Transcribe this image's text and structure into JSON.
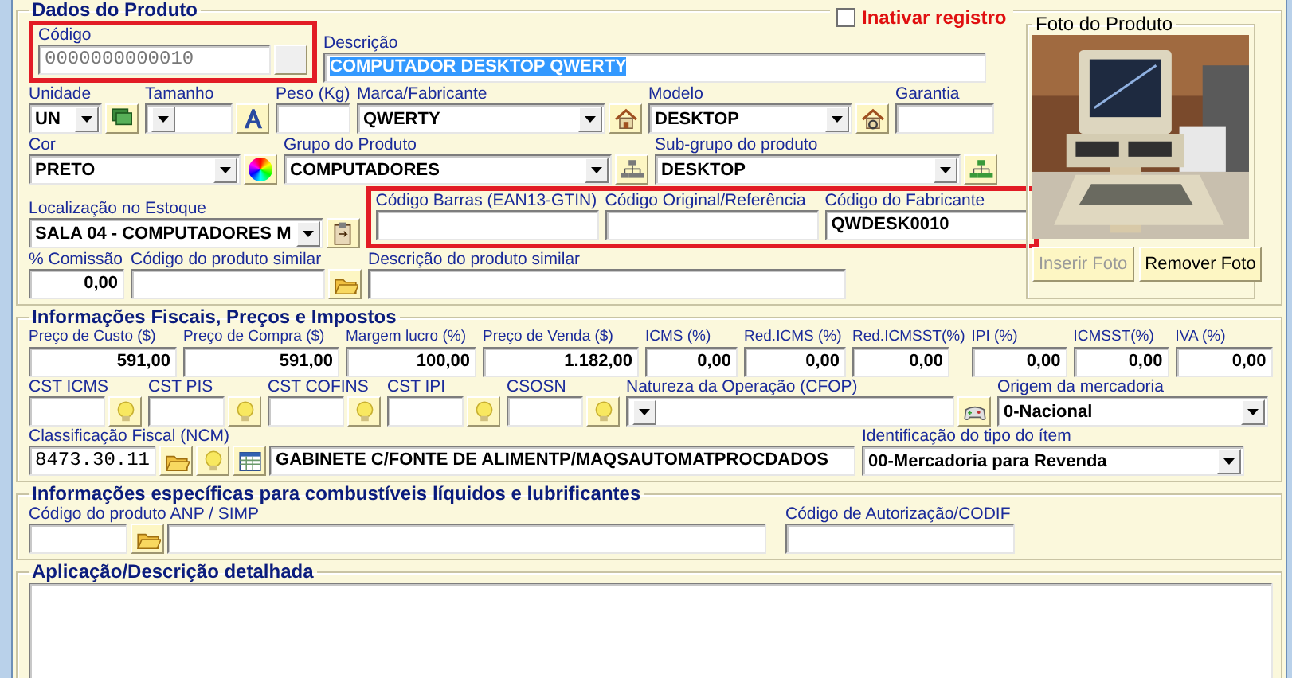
{
  "inactivate": {
    "label": "Inativar registro",
    "checked": false
  },
  "product": {
    "legend": "Dados do Produto",
    "code": {
      "label": "Código",
      "value": "0000000000010",
      "highlighted": true,
      "disabled": true
    },
    "description": {
      "label": "Descrição",
      "value": "COMPUTADOR DESKTOP QWERTY",
      "selected": true
    },
    "unit": {
      "label": "Unidade",
      "value": "UN"
    },
    "size": {
      "label": "Tamanho"
    },
    "weight": {
      "label": "Peso (Kg)"
    },
    "brand": {
      "label": "Marca/Fabricante",
      "value": "QWERTY"
    },
    "model": {
      "label": "Modelo",
      "value": "DESKTOP"
    },
    "warranty": {
      "label": "Garantia"
    },
    "color": {
      "label": "Cor",
      "value": "PRETO"
    },
    "group": {
      "label": "Grupo do Produto",
      "value": "COMPUTADORES"
    },
    "subgroup": {
      "label": "Sub-grupo do produto",
      "value": "DESKTOP"
    },
    "location": {
      "label": "Localização no Estoque",
      "value": "SALA 04 - COMPUTADORES M"
    },
    "codes": {
      "highlighted": true,
      "fields": [
        {
          "label": "Código Barras (EAN13-GTIN)"
        },
        {
          "label": "Código Original/Referência"
        },
        {
          "label": "Código do Fabricante",
          "value": "QWDESK0010"
        }
      ]
    },
    "commission": {
      "label": "% Comissão",
      "value": "0,00"
    },
    "similar_code": {
      "label": "Código do produto similar"
    },
    "similar_description": {
      "label": "Descrição do produto similar"
    }
  },
  "photo": {
    "legend": "Foto do Produto",
    "kind": "picture",
    "buttons": [
      {
        "label": "Inserir Foto",
        "disabled": true
      },
      {
        "label": "Remover Foto",
        "disabled": false
      }
    ]
  },
  "fiscal": {
    "legend": "Informações Fiscais, Preços e Impostos",
    "prices": [
      {
        "label": "Preço de Custo ($)",
        "value": "591,00"
      },
      {
        "label": "Preço de Compra ($)",
        "value": "591,00"
      },
      {
        "label": "Margem lucro (%)",
        "value": "100,00"
      },
      {
        "label": "Preço de Venda ($)",
        "value": "1.182,00"
      },
      {
        "label": "ICMS (%)",
        "value": "0,00"
      },
      {
        "label": "Red.ICMS (%)",
        "value": "0,00"
      },
      {
        "label": "Red.ICMSST(%)",
        "value": "0,00"
      },
      {
        "label": "IPI (%)",
        "value": "0,00"
      },
      {
        "label": "ICMSST(%)",
        "value": "0,00"
      },
      {
        "label": "IVA (%)",
        "value": "0,00"
      }
    ],
    "cst": [
      {
        "label": "CST ICMS"
      },
      {
        "label": "CST PIS"
      },
      {
        "label": "CST COFINS"
      },
      {
        "label": "CST IPI"
      },
      {
        "label": "CSOSN"
      }
    ],
    "nature": {
      "label": "Natureza da Operação (CFOP)"
    },
    "origin": {
      "label": "Origem da mercadoria",
      "value": "0-Nacional"
    },
    "ncm": {
      "label": "Classificação Fiscal (NCM)",
      "value": "8473.30.11",
      "description": "GABINETE C/FONTE DE ALIMENTP/MAQSAUTOMATPROCDADOS"
    },
    "item_type": {
      "label": "Identificação do tipo do ítem",
      "value": "00-Mercadoria para Revenda"
    }
  },
  "fuel": {
    "legend": "Informações específicas para combustíveis líquidos e lubrificantes",
    "anp": {
      "label": "Código do produto ANP / SIMP"
    },
    "codif": {
      "label": "Código de Autorização/CODIF"
    }
  },
  "details": {
    "legend": "Aplicação/Descrição detalhada"
  }
}
